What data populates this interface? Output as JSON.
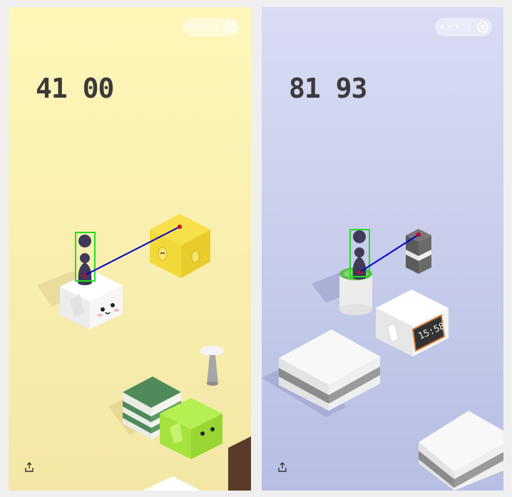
{
  "left_panel": {
    "score": "41 00",
    "background_color": "#fbf3b3",
    "capsule_icons": [
      "more-icon",
      "target-icon"
    ],
    "share_icon": "share-icon"
  },
  "right_panel": {
    "score": "81 93",
    "background_color": "#c8cdee",
    "capsule_icons": [
      "more-icon",
      "target-icon"
    ],
    "share_icon": "share-icon",
    "clock_display": "15:58"
  },
  "overlay_colors": {
    "bounding_box": "#22dd22",
    "aim_line": "#0000cc",
    "target_point": "#cc0033"
  }
}
